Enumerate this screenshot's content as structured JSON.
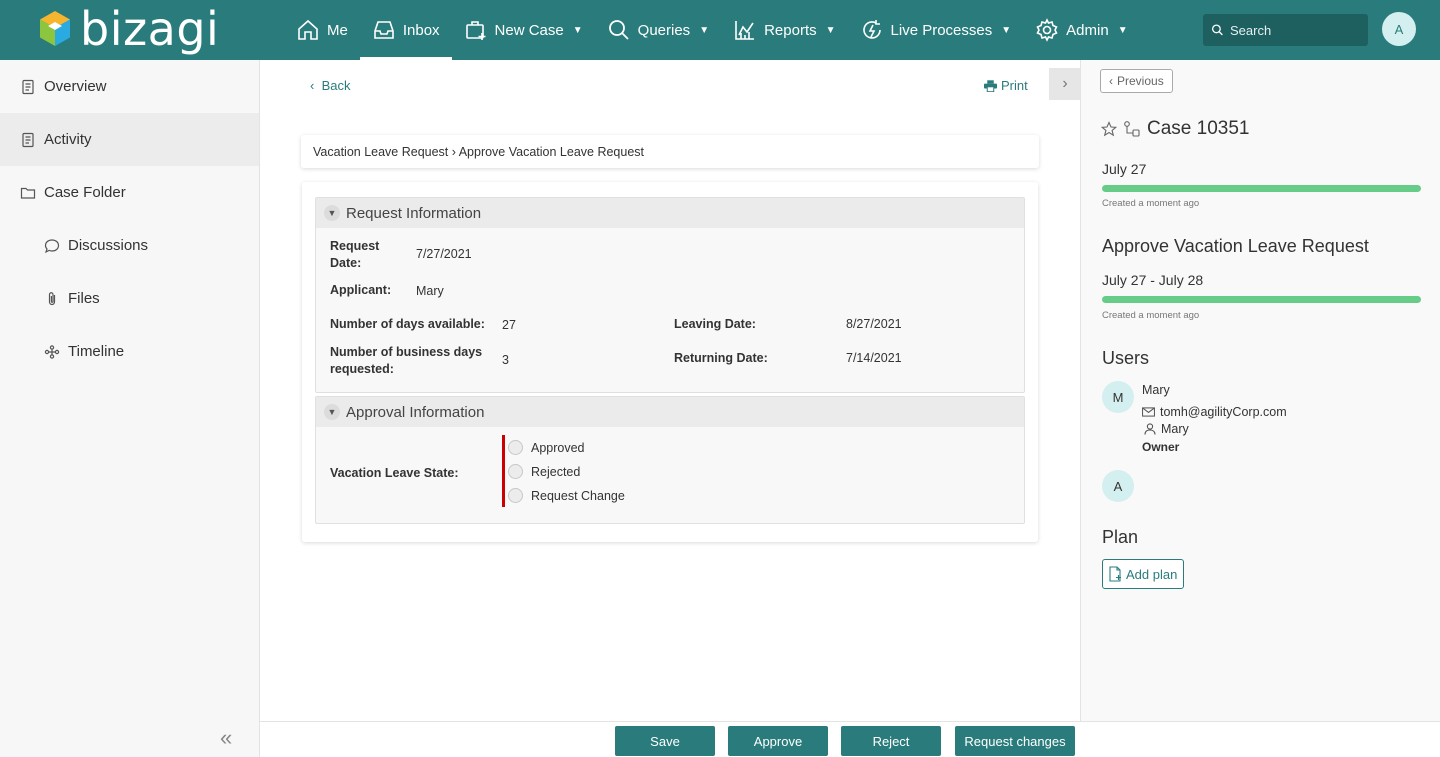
{
  "app": {
    "logo_text": "bizagi"
  },
  "nav": {
    "me": "Me",
    "inbox": "Inbox",
    "new_case": "New Case",
    "queries": "Queries",
    "reports": "Reports",
    "live_processes": "Live Processes",
    "admin": "Admin"
  },
  "search": {
    "placeholder": "Search"
  },
  "user": {
    "initial": "A"
  },
  "sidebar": {
    "items": [
      {
        "label": "Overview"
      },
      {
        "label": "Activity"
      },
      {
        "label": "Case Folder"
      },
      {
        "label": "Discussions"
      },
      {
        "label": "Files"
      },
      {
        "label": "Timeline"
      }
    ]
  },
  "main": {
    "back": "Back",
    "print": "Print",
    "breadcrumb": "Vacation Leave Request › Approve Vacation Leave Request",
    "request_info": {
      "title": "Request Information",
      "request_date_label_1": "Request",
      "request_date_label_2": "Date:",
      "request_date": "7/27/2021",
      "applicant_label": "Applicant:",
      "applicant": "Mary",
      "days_available_label": "Number of days available:",
      "days_available": "27",
      "business_days_label_1": "Number of business days",
      "business_days_label_2": "requested:",
      "business_days": "3",
      "leaving_date_label": "Leaving Date:",
      "leaving_date": "8/27/2021",
      "returning_date_label": "Returning Date:",
      "returning_date": "7/14/2021"
    },
    "approval_info": {
      "title": "Approval Information",
      "state_label": "Vacation Leave State:",
      "options": [
        "Approved",
        "Rejected",
        "Request Change"
      ]
    }
  },
  "right": {
    "previous": "Previous",
    "case_title": "Case 10351",
    "case_date": "July 27",
    "case_created": "Created a moment ago",
    "task_title": "Approve Vacation Leave Request",
    "task_date": "July 27 - July 28",
    "task_created": "Created a moment ago",
    "users_heading": "Users",
    "user1_initial": "M",
    "user1_name": "Mary",
    "user1_email": "tomh@agilityCorp.com",
    "user1_display": "Mary",
    "user1_role": "Owner",
    "user2_initial": "A",
    "plan_heading": "Plan",
    "add_plan": "Add plan"
  },
  "actions": {
    "save": "Save",
    "approve": "Approve",
    "reject": "Reject",
    "request_changes": "Request changes"
  },
  "colors": {
    "brand": "#2a7c7c",
    "progress": "#66cc88",
    "required": "#cc0000"
  }
}
